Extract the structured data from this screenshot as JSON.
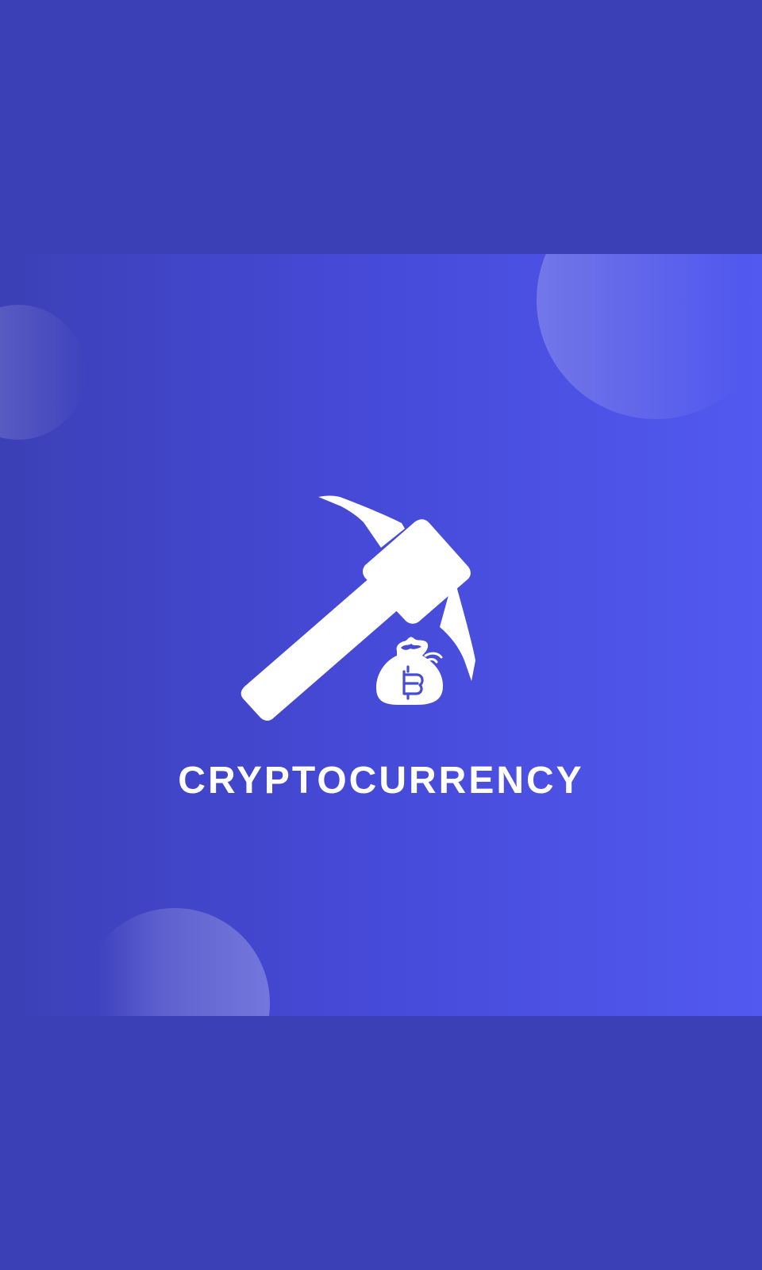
{
  "splash": {
    "title": "CRYPTOCURRENCY",
    "logo_icon": "pickaxe-bitcoin-bag-icon",
    "colors": {
      "background": "#3c40b6",
      "gradient_start": "#3c40b6",
      "gradient_end": "#5259f0",
      "foreground": "#ffffff"
    }
  }
}
